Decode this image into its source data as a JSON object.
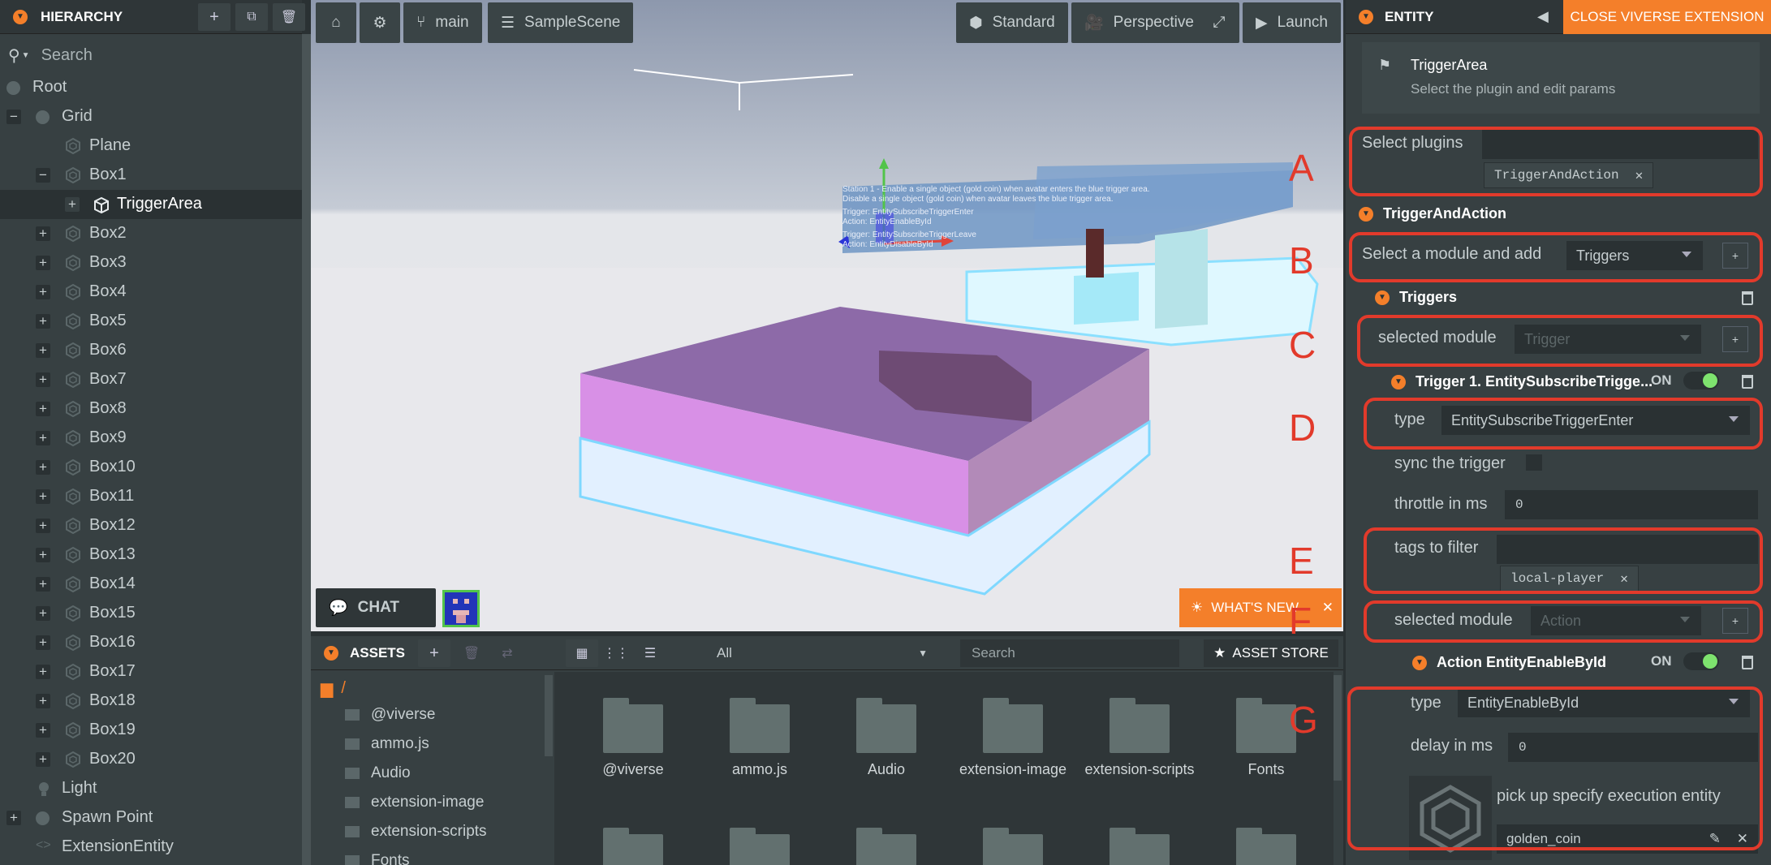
{
  "hierarchy": {
    "title": "HIERARCHY",
    "search_placeholder": "Search",
    "items": [
      {
        "label": "Root",
        "indent": 0,
        "toggle": "",
        "icon": "dot"
      },
      {
        "label": "Grid",
        "indent": 1,
        "toggle": "−",
        "icon": "dot"
      },
      {
        "label": "Plane",
        "indent": 2,
        "toggle": "",
        "icon": "hex"
      },
      {
        "label": "Box1",
        "indent": 2,
        "toggle": "−",
        "icon": "hex"
      },
      {
        "label": "TriggerArea",
        "indent": 3,
        "toggle": "+",
        "icon": "cube",
        "selected": true
      },
      {
        "label": "Box2",
        "indent": 2,
        "toggle": "+",
        "icon": "hex"
      },
      {
        "label": "Box3",
        "indent": 2,
        "toggle": "+",
        "icon": "hex"
      },
      {
        "label": "Box4",
        "indent": 2,
        "toggle": "+",
        "icon": "hex"
      },
      {
        "label": "Box5",
        "indent": 2,
        "toggle": "+",
        "icon": "hex"
      },
      {
        "label": "Box6",
        "indent": 2,
        "toggle": "+",
        "icon": "hex"
      },
      {
        "label": "Box7",
        "indent": 2,
        "toggle": "+",
        "icon": "hex"
      },
      {
        "label": "Box8",
        "indent": 2,
        "toggle": "+",
        "icon": "hex"
      },
      {
        "label": "Box9",
        "indent": 2,
        "toggle": "+",
        "icon": "hex"
      },
      {
        "label": "Box10",
        "indent": 2,
        "toggle": "+",
        "icon": "hex"
      },
      {
        "label": "Box11",
        "indent": 2,
        "toggle": "+",
        "icon": "hex"
      },
      {
        "label": "Box12",
        "indent": 2,
        "toggle": "+",
        "icon": "hex"
      },
      {
        "label": "Box13",
        "indent": 2,
        "toggle": "+",
        "icon": "hex"
      },
      {
        "label": "Box14",
        "indent": 2,
        "toggle": "+",
        "icon": "hex"
      },
      {
        "label": "Box15",
        "indent": 2,
        "toggle": "+",
        "icon": "hex"
      },
      {
        "label": "Box16",
        "indent": 2,
        "toggle": "+",
        "icon": "hex"
      },
      {
        "label": "Box17",
        "indent": 2,
        "toggle": "+",
        "icon": "hex"
      },
      {
        "label": "Box18",
        "indent": 2,
        "toggle": "+",
        "icon": "hex"
      },
      {
        "label": "Box19",
        "indent": 2,
        "toggle": "+",
        "icon": "hex"
      },
      {
        "label": "Box20",
        "indent": 2,
        "toggle": "+",
        "icon": "hex"
      },
      {
        "label": "Light",
        "indent": 1,
        "toggle": "",
        "icon": "bulb"
      },
      {
        "label": "Spawn Point",
        "indent": 1,
        "toggle": "+",
        "icon": "dot"
      },
      {
        "label": "ExtensionEntity",
        "indent": 1,
        "toggle": "",
        "icon": "code"
      }
    ]
  },
  "viewport": {
    "branch": "main",
    "scene": "SampleScene",
    "render_mode": "Standard",
    "camera": "Perspective",
    "launch": "Launch",
    "chat": "CHAT",
    "whats_new": "WHAT'S NEW",
    "sign_text": {
      "line1": "Station 1 - Enable a single object (gold coin) when avatar enters the blue trigger area.",
      "line2": "Disable a single object (gold coin) when avatar leaves the blue trigger area.",
      "line3": "Trigger: EntitySubscribeTriggerEnter",
      "line4": "Action: EntityEnableById",
      "line5": "Trigger: EntitySubscribeTriggerLeave",
      "line6": "Action: EntityDisableById"
    }
  },
  "assets": {
    "title": "ASSETS",
    "filter": "All",
    "search_placeholder": "Search",
    "store": "ASSET STORE",
    "root": "/",
    "tree": [
      "@viverse",
      "ammo.js",
      "Audio",
      "extension-image",
      "extension-scripts",
      "Fonts"
    ],
    "folders": [
      "@viverse",
      "ammo.js",
      "Audio",
      "extension-image",
      "extension-scripts",
      "Fonts"
    ]
  },
  "entity": {
    "title": "ENTITY",
    "close": "CLOSE VIVERSE EXTENSION",
    "name": "TriggerArea",
    "hint": "Select the plugin and edit params",
    "select_plugins": "Select plugins",
    "plugin_tag": "TriggerAndAction",
    "plugin_section": "TriggerAndAction",
    "select_module_add": "Select a module and add",
    "module_choice": "Triggers",
    "triggers_section": "Triggers",
    "selected_module": "selected module",
    "trigger_placeholder": "Trigger",
    "trigger1_title": "Trigger 1. EntitySubscribeTrigge...",
    "on": "ON",
    "type_label": "type",
    "trigger_type": "EntitySubscribeTriggerEnter",
    "sync": "sync the trigger",
    "throttle": "throttle in ms",
    "throttle_value": "0",
    "tags_filter": "tags to filter",
    "tag_value": "local-player",
    "selected_module2": "selected module",
    "action_placeholder": "Action",
    "action_title": "Action EntityEnableById",
    "on2": "ON",
    "type_label2": "type",
    "action_type": "EntityEnableById",
    "delay": "delay in ms",
    "delay_value": "0",
    "pick_up": "pick up specify execution entity",
    "entity_value": "golden_coin",
    "annotations": [
      "A",
      "B",
      "C",
      "D",
      "E",
      "F",
      "G"
    ]
  },
  "colors": {
    "accent": "#f47f2a",
    "panel": "#374042",
    "annotation": "#e23a2b",
    "toggle_on": "#7ee36e"
  }
}
